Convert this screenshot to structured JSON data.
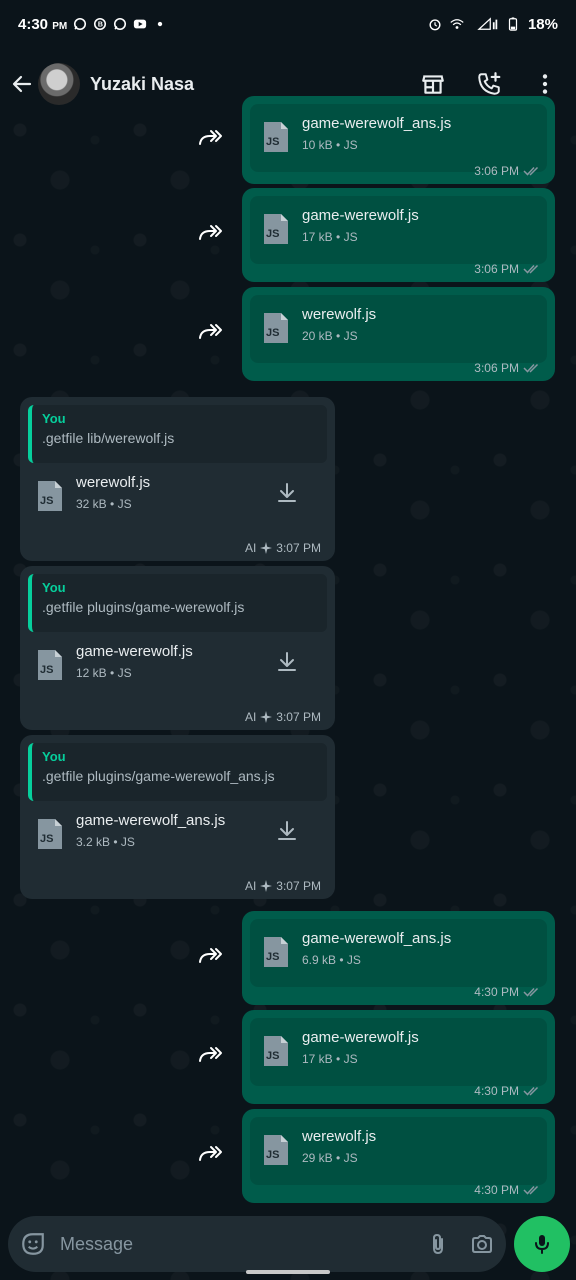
{
  "status_bar": {
    "time": "4:30",
    "ampm": "PM",
    "notification_icons": [
      "whatsapp-icon",
      "whatsapp-business-icon",
      "whatsapp-icon",
      "youtube-icon",
      "dot-icon"
    ],
    "battery": "18%"
  },
  "header": {
    "contact_name": "Yuzaki Nasa",
    "icons": [
      "back-arrow-icon",
      "store-icon",
      "add-call-icon",
      "more-vert-icon"
    ]
  },
  "messages": [
    {
      "id": "m1",
      "dir": "out",
      "forwarded": true,
      "file_name": "game-werewolf_ans.js",
      "size": "10 kB",
      "type": "JS",
      "time": "3:06 PM"
    },
    {
      "id": "m2",
      "dir": "out",
      "forwarded": true,
      "file_name": "game-werewolf.js",
      "size": "17 kB",
      "type": "JS",
      "time": "3:06 PM"
    },
    {
      "id": "m3",
      "dir": "out",
      "forwarded": true,
      "file_name": "werewolf.js",
      "size": "20 kB",
      "type": "JS",
      "time": "3:06 PM"
    },
    {
      "id": "m4",
      "dir": "in",
      "quote_author": "You",
      "quote_text": ".getfile lib/werewolf.js",
      "file_name": "werewolf.js",
      "size": "32 kB",
      "type": "JS",
      "ai": "AI",
      "time": "3:07 PM"
    },
    {
      "id": "m5",
      "dir": "in",
      "quote_author": "You",
      "quote_text": ".getfile plugins/game-werewolf.js",
      "file_name": "game-werewolf.js",
      "size": "12 kB",
      "type": "JS",
      "ai": "AI",
      "time": "3:07 PM"
    },
    {
      "id": "m6",
      "dir": "in",
      "quote_author": "You",
      "quote_text": ".getfile plugins/game-werewolf_ans.js",
      "file_name": "game-werewolf_ans.js",
      "size": "3.2 kB",
      "type": "JS",
      "ai": "AI",
      "time": "3:07 PM"
    },
    {
      "id": "m7",
      "dir": "out",
      "forwarded": true,
      "file_name": "game-werewolf_ans.js",
      "size": "6.9 kB",
      "type": "JS",
      "time": "4:30 PM"
    },
    {
      "id": "m8",
      "dir": "out",
      "forwarded": true,
      "file_name": "game-werewolf.js",
      "size": "17 kB",
      "type": "JS",
      "time": "4:30 PM"
    },
    {
      "id": "m9",
      "dir": "out",
      "forwarded": true,
      "file_name": "werewolf.js",
      "size": "29 kB",
      "type": "JS",
      "time": "4:30 PM"
    }
  ],
  "file_badge": "JS",
  "meta_separator": "•",
  "input": {
    "placeholder": "Message",
    "icons": [
      "sticker-icon",
      "attach-icon",
      "camera-icon",
      "mic-icon"
    ]
  },
  "colors": {
    "background": "#0b141a",
    "outgoing_bubble": "#005c4b",
    "incoming_bubble": "#202c33",
    "accent": "#21c063",
    "quote_bar": "#06cf9c",
    "read_ticks": "#8696a0"
  }
}
